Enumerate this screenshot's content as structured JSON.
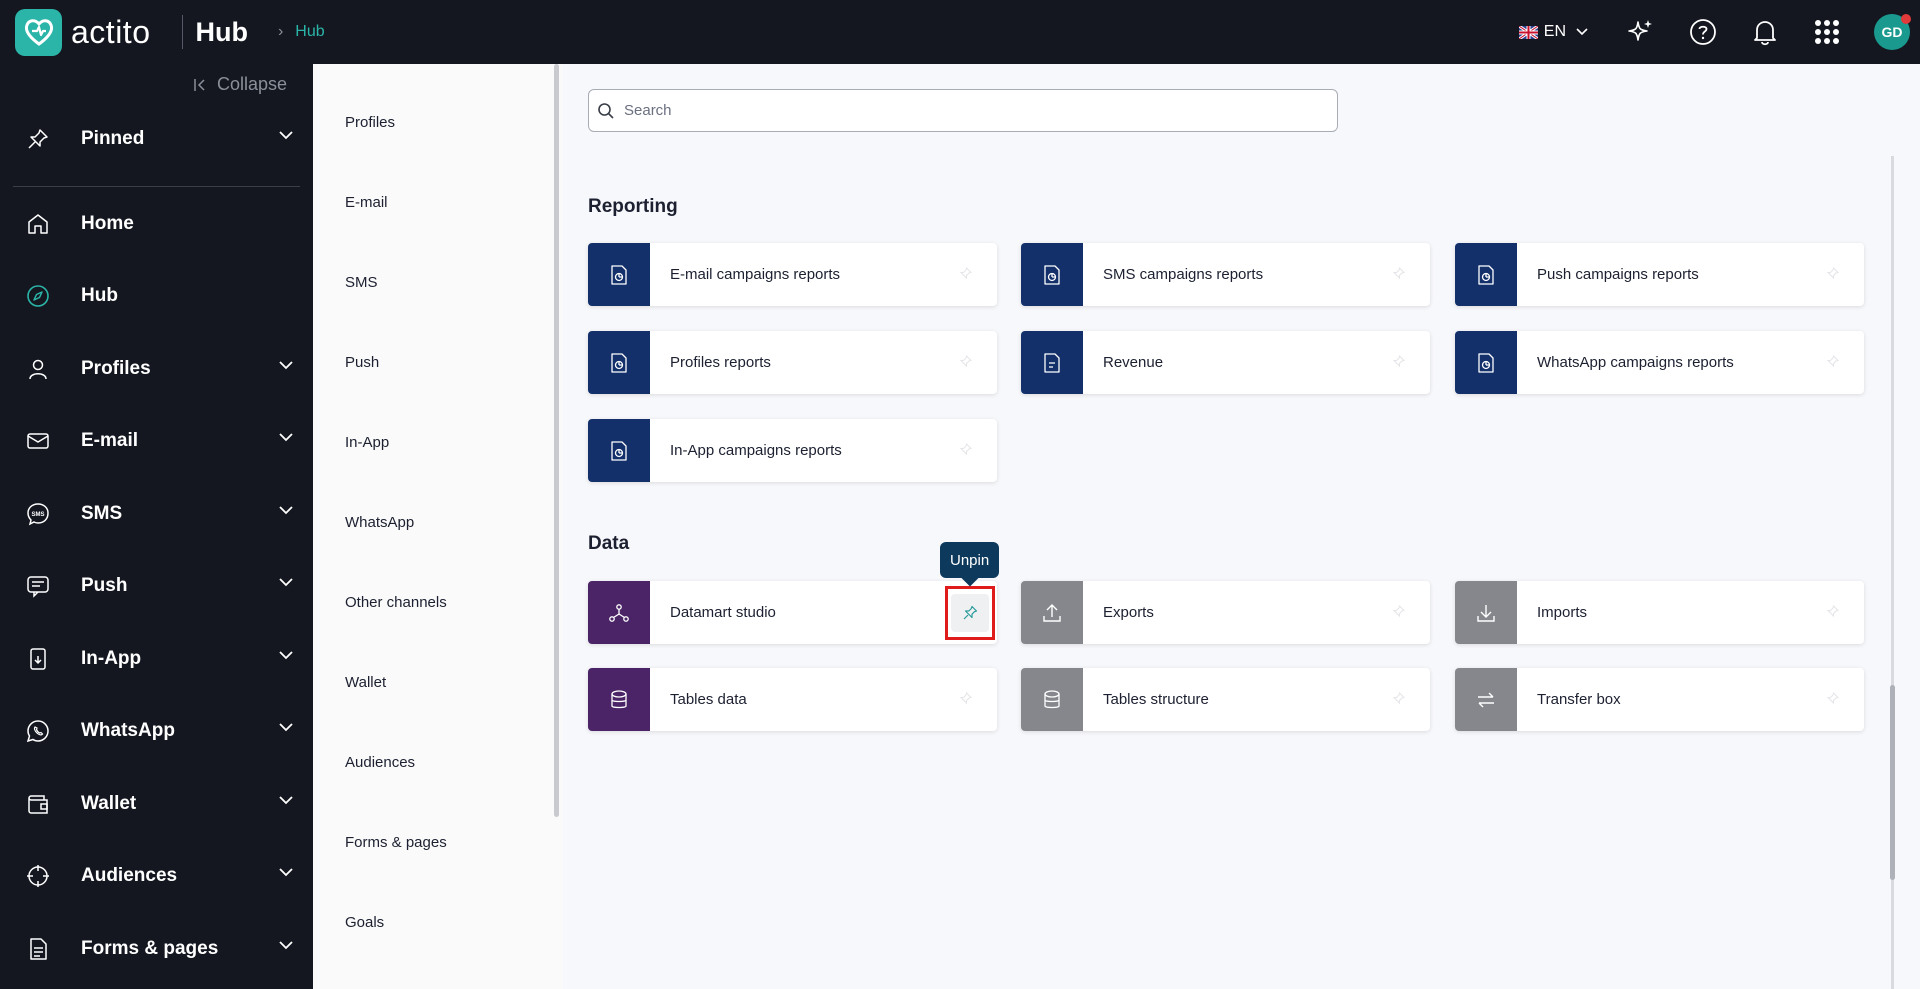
{
  "topbar": {
    "logo_text": "actito",
    "app_name": "Hub",
    "breadcrumb": "Hub",
    "language": "EN",
    "avatar_initials": "GD"
  },
  "leftnav": {
    "collapse_label": "Collapse",
    "items": [
      {
        "label": "Pinned",
        "icon": "pin-icon"
      },
      {
        "label": "Home",
        "icon": "home-icon"
      },
      {
        "label": "Hub",
        "icon": "compass-icon"
      },
      {
        "label": "Profiles",
        "icon": "user-icon"
      },
      {
        "label": "E-mail",
        "icon": "mail-icon"
      },
      {
        "label": "SMS",
        "icon": "sms-icon"
      },
      {
        "label": "Push",
        "icon": "push-icon"
      },
      {
        "label": "In-App",
        "icon": "phone-icon"
      },
      {
        "label": "WhatsApp",
        "icon": "whatsapp-icon"
      },
      {
        "label": "Wallet",
        "icon": "wallet-icon"
      },
      {
        "label": "Audiences",
        "icon": "target-icon"
      },
      {
        "label": "Forms & pages",
        "icon": "form-icon"
      }
    ]
  },
  "subnav": {
    "items": [
      "Profiles",
      "E-mail",
      "SMS",
      "Push",
      "In-App",
      "WhatsApp",
      "Other channels",
      "Wallet",
      "Audiences",
      "Forms & pages",
      "Goals"
    ]
  },
  "search": {
    "placeholder": "Search"
  },
  "sections": {
    "reporting": {
      "title": "Reporting",
      "cards": [
        {
          "label": "E-mail campaigns reports"
        },
        {
          "label": "SMS campaigns reports"
        },
        {
          "label": "Push campaigns reports"
        },
        {
          "label": "Profiles reports"
        },
        {
          "label": "Revenue"
        },
        {
          "label": "WhatsApp campaigns reports"
        },
        {
          "label": "In-App campaigns reports"
        }
      ]
    },
    "data": {
      "title": "Data",
      "cards": [
        {
          "label": "Datamart studio"
        },
        {
          "label": "Exports"
        },
        {
          "label": "Imports"
        },
        {
          "label": "Tables data"
        },
        {
          "label": "Tables structure"
        },
        {
          "label": "Transfer box"
        }
      ]
    }
  },
  "tooltip": {
    "text": "Unpin"
  },
  "colors": {
    "topbar_bg": "#141720",
    "accent": "#2bb5a8",
    "reporting_icon_bg": "#13306b",
    "data_purple": "#4a2466",
    "data_gray": "#85878c",
    "tooltip_bg": "#0d3a5c",
    "highlight": "#e01b1b"
  }
}
